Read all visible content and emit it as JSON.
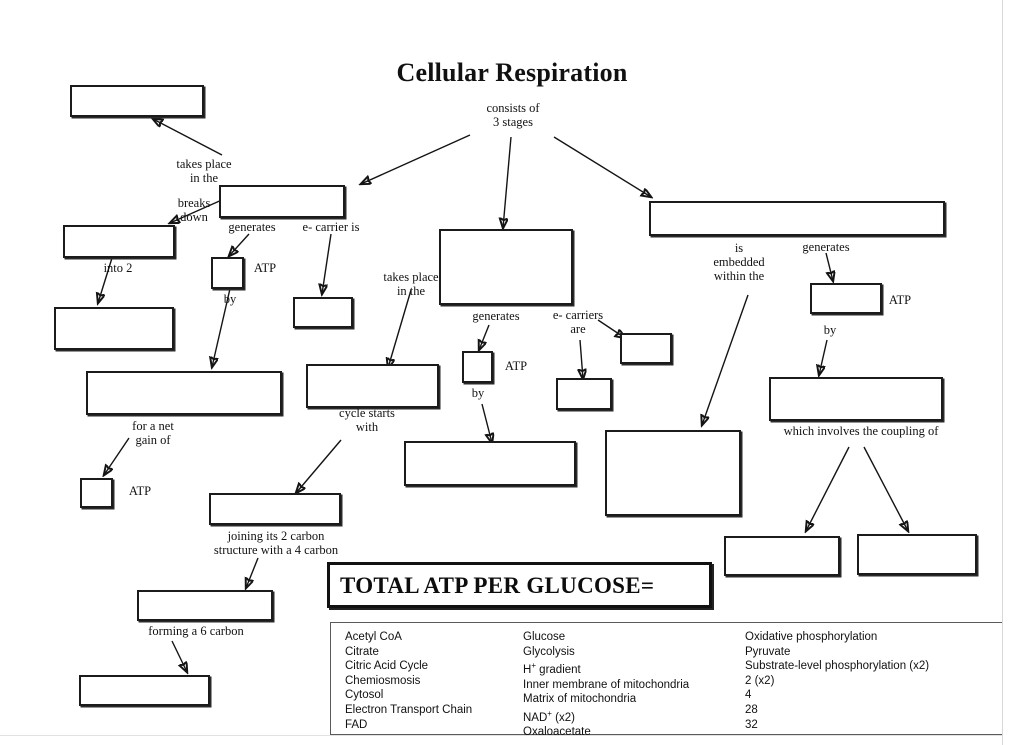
{
  "title": "Cellular Respiration",
  "connectors": [
    {
      "id": "consists-of",
      "text": "consists of\n3 stages"
    },
    {
      "id": "takes-place-in-the-1",
      "text": "takes place\nin the"
    },
    {
      "id": "breaks-down",
      "text": "breaks\ndown"
    },
    {
      "id": "into-2",
      "text": "into 2"
    },
    {
      "id": "generates-1",
      "text": "generates"
    },
    {
      "id": "e-carrier-is",
      "text": "e- carrier is"
    },
    {
      "id": "by-1",
      "text": "by"
    },
    {
      "id": "atp-1",
      "text": "ATP"
    },
    {
      "id": "for-a-net-gain-of",
      "text": "for a net\ngain of"
    },
    {
      "id": "atp-2",
      "text": "ATP"
    },
    {
      "id": "takes-place-in-the-2",
      "text": "takes place\nin the"
    },
    {
      "id": "cycle-starts-with",
      "text": "cycle starts\nwith"
    },
    {
      "id": "joining-2-carbon",
      "text": "joining its 2 carbon\nstructure with a 4 carbon"
    },
    {
      "id": "forming-6-carbon",
      "text": "forming a 6 carbon"
    },
    {
      "id": "generates-2",
      "text": "generates"
    },
    {
      "id": "atp-3",
      "text": "ATP"
    },
    {
      "id": "by-2",
      "text": "by"
    },
    {
      "id": "e-carriers-are",
      "text": "e- carriers\nare"
    },
    {
      "id": "is-embedded-within-the",
      "text": "is\nembedded\nwithin the"
    },
    {
      "id": "generates-3",
      "text": "generates"
    },
    {
      "id": "atp-4",
      "text": "ATP"
    },
    {
      "id": "by-3",
      "text": "by"
    },
    {
      "id": "which-involves-coupling",
      "text": "which involves the coupling of"
    }
  ],
  "answer_boxes": [
    {
      "id": "box-cytosol",
      "value": ""
    },
    {
      "id": "box-glycolysis",
      "value": ""
    },
    {
      "id": "box-pyruvate",
      "value": ""
    },
    {
      "id": "box-nad-x2",
      "value": ""
    },
    {
      "id": "box-2-atp",
      "value": ""
    },
    {
      "id": "box-substrate-level-1",
      "value": ""
    },
    {
      "id": "box-acetyl-coa",
      "value": ""
    },
    {
      "id": "box-glucose",
      "value": ""
    },
    {
      "id": "box-citric-acid-cycle",
      "value": ""
    },
    {
      "id": "box-matrix-of-mitochondria",
      "value": ""
    },
    {
      "id": "box-oxaloacetate",
      "value": ""
    },
    {
      "id": "box-citrate",
      "value": ""
    },
    {
      "id": "box-2-atp-2",
      "value": ""
    },
    {
      "id": "box-substrate-level-2",
      "value": ""
    },
    {
      "id": "box-nad-fad",
      "value": ""
    },
    {
      "id": "box-fad",
      "value": ""
    },
    {
      "id": "box-etc-carriers",
      "value": ""
    },
    {
      "id": "box-oxidative-phosphorylation",
      "value": ""
    },
    {
      "id": "box-inner-membrane",
      "value": ""
    },
    {
      "id": "box-electron-transport-chain",
      "value": ""
    },
    {
      "id": "box-28-atp",
      "value": ""
    },
    {
      "id": "box-chemiosmosis",
      "value": ""
    },
    {
      "id": "box-h-gradient",
      "value": ""
    },
    {
      "id": "box-atp-synthase",
      "value": ""
    }
  ],
  "total_banner": {
    "label": "TOTAL ATP PER GLUCOSE=",
    "answer": ""
  },
  "word_bank": {
    "column1": [
      "Acetyl CoA",
      "Citrate",
      "Citric Acid Cycle",
      "Chemiosmosis",
      "Cytosol",
      "Electron Transport Chain",
      "FAD"
    ],
    "column2": [
      "Glucose",
      "Glycolysis",
      "H+ gradient",
      "Inner membrane of mitochondria",
      "Matrix of mitochondria",
      "NAD+ (x2)",
      "Oxaloacetate"
    ],
    "column3": [
      "Oxidative phosphorylation",
      "Pyruvate",
      "Substrate-level phosphorylation (x2)",
      "2 (x2)",
      "4",
      "28",
      "32"
    ]
  },
  "colors": {
    "ink": "#111111",
    "paper": "#ffffff",
    "rule": "#5a5a5a"
  }
}
